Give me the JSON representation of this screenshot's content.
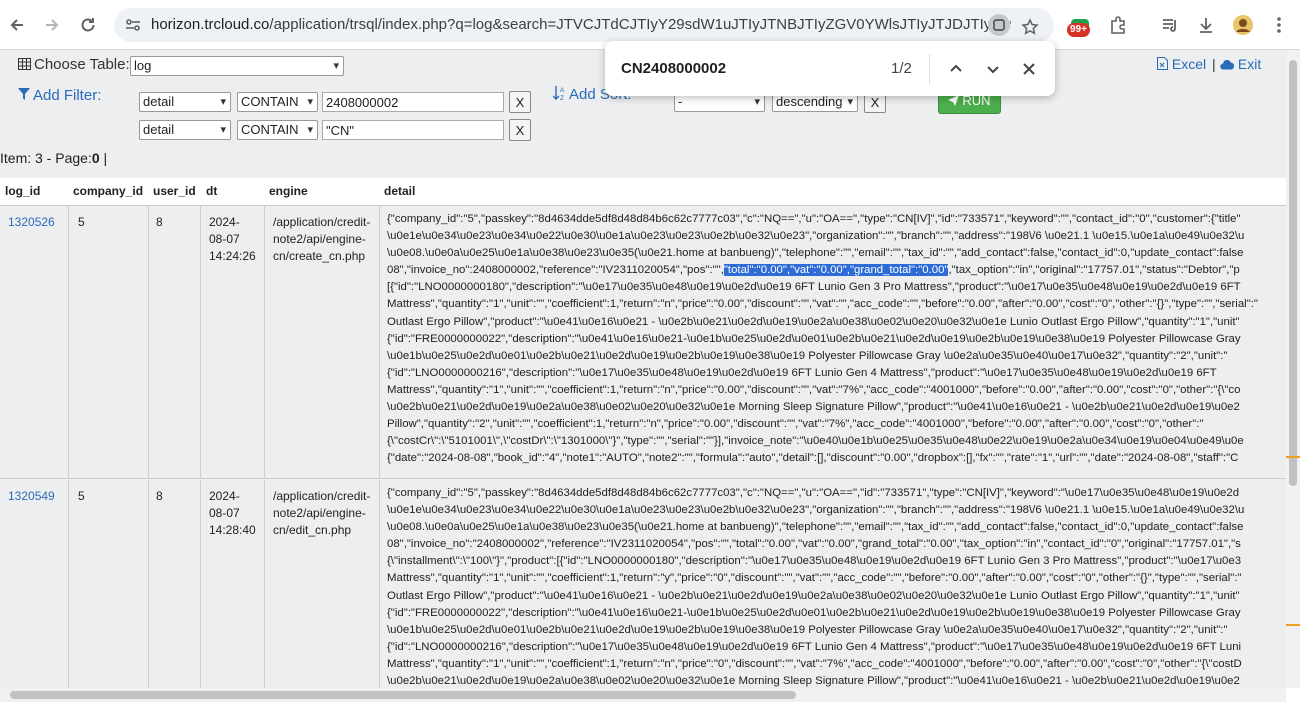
{
  "browser": {
    "url_host": "horizon.trcloud.co",
    "url_path": "/application/trsql/index.php?q=log&search=JTVCJTdCJTIyY29sdW1uJTIyJTNBJTIyZGV0YWlsJTIyJTJDJTIyY29...",
    "extension_badge": "99+"
  },
  "header": {
    "choose_table_label": "Choose Table:",
    "table_value": "log",
    "add_filter_label": "Add Filter:",
    "add_sort_label": "Add Sort:",
    "filters": [
      {
        "column": "detail",
        "operator": "CONTAIN",
        "value": "2408000002",
        "remove": "X"
      },
      {
        "column": "detail",
        "operator": "CONTAIN",
        "value": "\"CN\"",
        "remove": "X"
      }
    ],
    "sort": {
      "column": "-",
      "direction": "descending",
      "remove": "X"
    },
    "run_label": "RUN",
    "excel_label": "Excel",
    "exit_label": "Exit",
    "link_separator": "|",
    "meta_prefix": "Item: 3 - Page:",
    "meta_page": "0",
    "meta_suffix": " |"
  },
  "find": {
    "query": "CN2408000002",
    "count": "1/2"
  },
  "table": {
    "columns": [
      "log_id",
      "company_id",
      "user_id",
      "dt",
      "engine",
      "detail"
    ],
    "rows": [
      {
        "log_id": "1320526",
        "company_id": "5",
        "user_id": "8",
        "dt_lines": [
          "2024-",
          "08-07",
          "14:24:26"
        ],
        "engine_lines": [
          "/application/credit-",
          "note2/api/engine-",
          "cn/create_cn.php"
        ],
        "detail_lines": [
          "{\"company_id\":\"5\",\"passkey\":\"8d4634dde5df8d48d84b6c62c7777c03\",\"c\":\"NQ==\",\"u\":\"OA==\",\"type\":\"CN[IV]\",\"id\":\"733571\",\"keyword\":\"\",\"contact_id\":\"0\",\"customer\":{\"title\"",
          "\\u0e1e\\u0e34\\u0e23\\u0e34\\u0e22\\u0e30\\u0e1a\\u0e23\\u0e23\\u0e2b\\u0e32\\u0e23\",\"organization\":\"\",\"branch\":\"\",\"address\":\"198\\/6 \\u0e21.1 \\u0e15.\\u0e1a\\u0e49\\u0e32\\u",
          "\\u0e08.\\u0e0a\\u0e25\\u0e1a\\u0e38\\u0e23\\u0e35(\\u0e21.home at banbueng)\",\"telephone\":\"\",\"email\":\"\",\"tax_id\":\"\",\"add_contact\":false,\"contact_id\":0,\"update_contact\":false",
          "08\",\"invoice_no\":2408000002,\"reference\":\"IV2311020054\",\"pos\":\"\",",
          "[{\"id\":\"LNO0000000180\",\"description\":\"\\u0e17\\u0e35\\u0e48\\u0e19\\u0e2d\\u0e19 6FT Lunio Gen 3 Pro Mattress\",\"product\":\"\\u0e17\\u0e35\\u0e48\\u0e19\\u0e2d\\u0e19 6FT",
          "Mattress\",\"quantity\":\"1\",\"unit\":\"\",\"coefficient\":1,\"return\":\"n\",\"price\":\"0.00\",\"discount\":\"\",\"vat\":\"\",\"acc_code\":\"\",\"before\":\"0.00\",\"after\":\"0.00\",\"cost\":\"0\",\"other\":\"{}\",\"type\":\"\",\"serial\":\"",
          "Outlast Ergo Pillow\",\"product\":\"\\u0e41\\u0e16\\u0e21 - \\u0e2b\\u0e21\\u0e2d\\u0e19\\u0e2a\\u0e38\\u0e02\\u0e20\\u0e32\\u0e1e Lunio Outlast Ergo Pillow\",\"quantity\":\"1\",\"unit\"",
          "{\"id\":\"FRE0000000022\",\"description\":\"\\u0e41\\u0e16\\u0e21-\\u0e1b\\u0e25\\u0e2d\\u0e01\\u0e2b\\u0e21\\u0e2d\\u0e19\\u0e2b\\u0e19\\u0e38\\u0e19 Polyester Pillowcase Gray",
          "\\u0e1b\\u0e25\\u0e2d\\u0e01\\u0e2b\\u0e21\\u0e2d\\u0e19\\u0e2b\\u0e19\\u0e38\\u0e19 Polyester Pillowcase Gray \\u0e2a\\u0e35\\u0e40\\u0e17\\u0e32\",\"quantity\":\"2\",\"unit\":\"",
          "{\"id\":\"LNO0000000216\",\"description\":\"\\u0e17\\u0e35\\u0e48\\u0e19\\u0e2d\\u0e19 6FT Lunio Gen 4 Mattress\",\"product\":\"\\u0e17\\u0e35\\u0e48\\u0e19\\u0e2d\\u0e19 6FT",
          "Mattress\",\"quantity\":\"1\",\"unit\":\"\",\"coefficient\":1,\"return\":\"n\",\"price\":\"0.00\",\"discount\":\"\",\"vat\":\"7%\",\"acc_code\":\"4001000\",\"before\":\"0.00\",\"after\":\"0.00\",\"cost\":\"0\",\"other\":\"{\\\"co",
          "\\u0e2b\\u0e21\\u0e2d\\u0e19\\u0e2a\\u0e38\\u0e02\\u0e20\\u0e32\\u0e1e Morning Sleep Signature Pillow\",\"product\":\"\\u0e41\\u0e16\\u0e21 - \\u0e2b\\u0e21\\u0e2d\\u0e19\\u0e2",
          "Pillow\",\"quantity\":\"2\",\"unit\":\"\",\"coefficient\":1,\"return\":\"n\",\"price\":\"0.00\",\"discount\":\"\",\"vat\":\"7%\",\"acc_code\":\"4001000\",\"before\":\"0.00\",\"after\":\"0.00\",\"cost\":\"0\",\"other\":\"",
          "{\\\"costCr\\\":\\\"5101001\\\",\\\"costDr\\\":\\\"1301000\\\"}\",\"type\":\"\",\"serial\":\"\"}],\"invoice_note\":\"\\u0e40\\u0e1b\\u0e25\\u0e35\\u0e48\\u0e22\\u0e19\\u0e2a\\u0e34\\u0e19\\u0e04\\u0e49\\u0e",
          "{\"date\":\"2024-08-08\",\"book_id\":\"4\",\"note1\":\"AUTO\",\"note2\":\"\",\"formula\":\"auto\",\"detail\":[],\"discount\":\"0.00\",\"dropbox\":[],\"fx\":\"\",\"rate\":\"1\",\"url\":\"\",\"date\":\"2024-08-08\",\"staff\":\"C"
        ],
        "highlight_line": 3,
        "highlight_text": "\"total\":\"0.00\",\"vat\":\"0.00\",\"grand_total\":\"0.00\"",
        "after_highlight": ",\"tax_option\":\"in\",\"original\":\"17757.01\",\"status\":\"Debtor\",\"p"
      },
      {
        "log_id": "1320549",
        "company_id": "5",
        "user_id": "8",
        "dt_lines": [
          "2024-",
          "08-07",
          "14:28:40"
        ],
        "engine_lines": [
          "/application/credit-",
          "note2/api/engine-",
          "cn/edit_cn.php"
        ],
        "detail_lines": [
          "{\"company_id\":\"5\",\"passkey\":\"8d4634dde5df8d48d84b6c62c7777c03\",\"c\":\"NQ==\",\"u\":\"OA==\",\"id\":\"733571\",\"type\":\"CN[IV]\",\"keyword\":\"\\u0e17\\u0e35\\u0e48\\u0e19\\u0e2d",
          "\\u0e1e\\u0e34\\u0e23\\u0e34\\u0e22\\u0e30\\u0e1a\\u0e23\\u0e23\\u0e2b\\u0e32\\u0e23\",\"organization\":\"\",\"branch\":\"\",\"address\":\"198\\/6 \\u0e21.1 \\u0e15.\\u0e1a\\u0e49\\u0e32\\u",
          "\\u0e08.\\u0e0a\\u0e25\\u0e1a\\u0e38\\u0e23\\u0e35(\\u0e21.home at banbueng)\",\"telephone\":\"\",\"email\":\"\",\"tax_id\":\"\",\"add_contact\":false,\"contact_id\":0,\"update_contact\":false",
          "08\",\"invoice_no\":\"2408000002\",\"reference\":\"IV2311020054\",\"pos\":\"\",\"total\":\"0.00\",\"vat\":\"0.00\",\"grand_total\":\"0.00\",\"tax_option\":\"in\",\"contact_id\":\"0\",\"original\":\"17757.01\",\"s",
          "{\\\"installment\\\":\\\"100\\\"}\",\"product\":[{\"id\":\"LNO0000000180\",\"description\":\"\\u0e17\\u0e35\\u0e48\\u0e19\\u0e2d\\u0e19 6FT Lunio Gen 3 Pro Mattress\",\"product\":\"\\u0e17\\u0e3",
          "Mattress\",\"quantity\":\"1\",\"unit\":\"\",\"coefficient\":1,\"return\":\"y\",\"price\":\"0\",\"discount\":\"\",\"vat\":\"\",\"acc_code\":\"\",\"before\":\"0.00\",\"after\":\"0.00\",\"cost\":\"0\",\"other\":\"{}\",\"type\":\"\",\"serial\":\"",
          "Outlast Ergo Pillow\",\"product\":\"\\u0e41\\u0e16\\u0e21 - \\u0e2b\\u0e21\\u0e2d\\u0e19\\u0e2a\\u0e38\\u0e02\\u0e20\\u0e32\\u0e1e Lunio Outlast Ergo Pillow\",\"quantity\":\"1\",\"unit\"",
          "{\"id\":\"FRE0000000022\",\"description\":\"\\u0e41\\u0e16\\u0e21-\\u0e1b\\u0e25\\u0e2d\\u0e01\\u0e2b\\u0e21\\u0e2d\\u0e19\\u0e2b\\u0e19\\u0e38\\u0e19 Polyester Pillowcase Gray",
          "\\u0e1b\\u0e25\\u0e2d\\u0e01\\u0e2b\\u0e21\\u0e2d\\u0e19\\u0e2b\\u0e19\\u0e38\\u0e19 Polyester Pillowcase Gray \\u0e2a\\u0e35\\u0e40\\u0e17\\u0e32\",\"quantity\":\"2\",\"unit\":\"",
          "{\"id\":\"LNO0000000216\",\"description\":\"\\u0e17\\u0e35\\u0e48\\u0e19\\u0e2d\\u0e19 6FT Lunio Gen 4 Mattress\",\"product\":\"\\u0e17\\u0e35\\u0e48\\u0e19\\u0e2d\\u0e19 6FT Luni",
          "Mattress\",\"quantity\":\"1\",\"unit\":\"\",\"coefficient\":1,\"return\":\"n\",\"price\":\"0\",\"discount\":\"\",\"vat\":\"7%\",\"acc_code\":\"4001000\",\"before\":\"0.00\",\"after\":\"0.00\",\"cost\":\"0\",\"other\":\"{\\\"costD",
          "\\u0e2b\\u0e21\\u0e2d\\u0e19\\u0e2a\\u0e38\\u0e02\\u0e20\\u0e32\\u0e1e Morning Sleep Signature Pillow\",\"product\":\"\\u0e41\\u0e16\\u0e21 - \\u0e2b\\u0e21\\u0e2d\\u0e19\\u0e2"
        ]
      }
    ]
  },
  "colors": {
    "app_bg": "#eceeef",
    "link": "#2a6bb8",
    "run_green": "#4cae4c",
    "find_highlight": "#2d6bd6",
    "scroll_mark": "#f0a020"
  },
  "icons": [
    "back-icon",
    "forward-icon",
    "reload-icon",
    "site-info-icon",
    "cast-icon",
    "bookmark-star-icon",
    "extension-shield-icon",
    "puzzle-icon",
    "media-icon",
    "download-icon",
    "profile-icon",
    "menu-icon",
    "table-icon",
    "filter-icon",
    "sort-icon",
    "excel-icon",
    "cloud-icon",
    "paper-plane-icon",
    "chevron-up-icon",
    "chevron-down-icon",
    "close-icon"
  ]
}
